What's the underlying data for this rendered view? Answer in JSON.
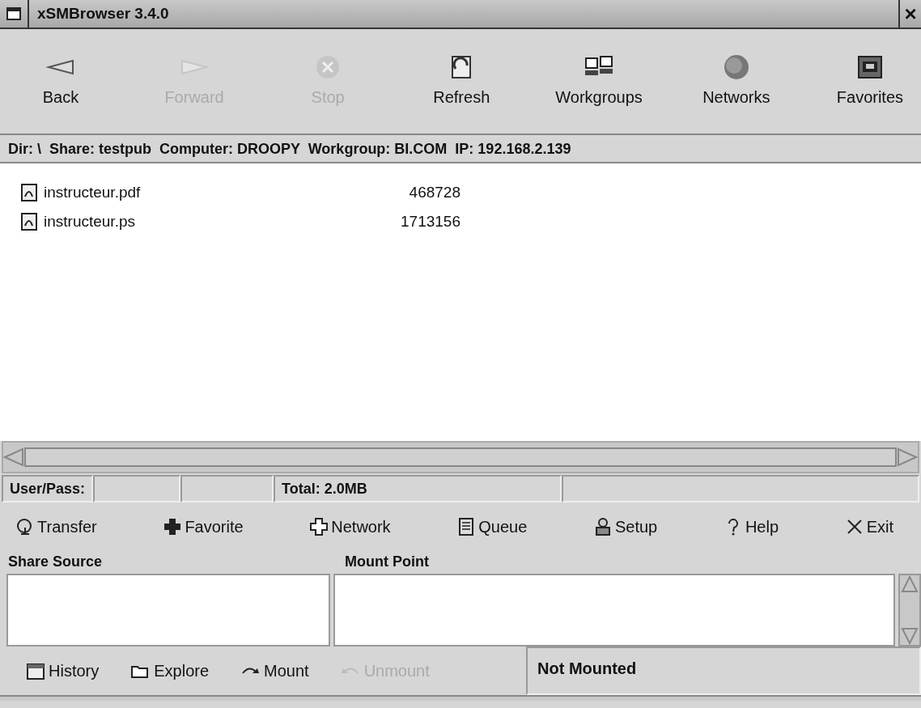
{
  "window": {
    "title": "xSMBrowser 3.4.0",
    "close": "×"
  },
  "toolbar": [
    {
      "label": "Back",
      "disabled": false
    },
    {
      "label": "Forward",
      "disabled": true
    },
    {
      "label": "Stop",
      "disabled": true
    },
    {
      "label": "Refresh",
      "disabled": false
    },
    {
      "label": "Workgroups",
      "disabled": false
    },
    {
      "label": "Networks",
      "disabled": false
    },
    {
      "label": "Favorites",
      "disabled": false
    }
  ],
  "info_bar": "Dir: \\  Share: testpub  Computer: DROOPY  Workgroup: BI.COM  IP: 192.168.2.139",
  "files": [
    {
      "name": "instructeur.pdf",
      "size": "468728"
    },
    {
      "name": "instructeur.ps",
      "size": "1713156"
    }
  ],
  "status_bar": {
    "user_label": "User/Pass:",
    "total": "Total: 2.0MB"
  },
  "actions": [
    {
      "label": "Transfer"
    },
    {
      "label": "Favorite"
    },
    {
      "label": "Network"
    },
    {
      "label": "Queue"
    },
    {
      "label": "Setup"
    },
    {
      "label": "Help"
    },
    {
      "label": "Exit"
    }
  ],
  "mount_table": {
    "columns": [
      "Share Source",
      "Mount Point"
    ]
  },
  "bottom_bar": [
    {
      "label": "History",
      "disabled": false
    },
    {
      "label": "Explore",
      "disabled": false
    },
    {
      "label": "Mount",
      "disabled": false
    },
    {
      "label": "Unmount",
      "disabled": true
    }
  ],
  "mount_status": "Not Mounted"
}
